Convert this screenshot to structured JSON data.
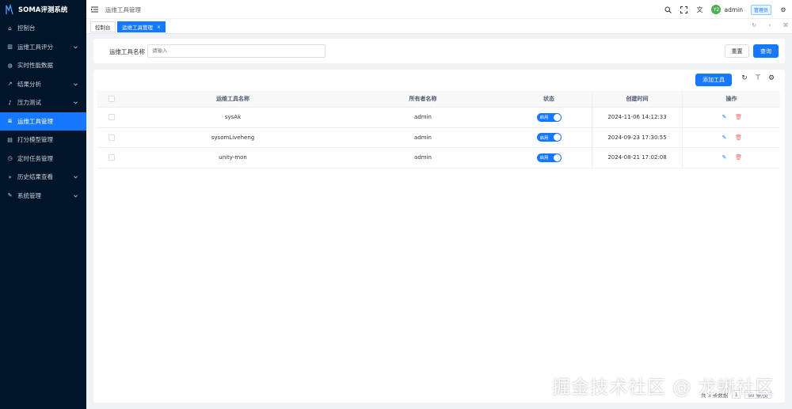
{
  "app": {
    "title": "SOMA评测系统"
  },
  "sidebar": {
    "items": [
      {
        "label": "控制台",
        "icon": "home-icon",
        "has_children": false,
        "active": false
      },
      {
        "label": "运维工具评分",
        "icon": "chart-icon",
        "has_children": true,
        "active": false
      },
      {
        "label": "实时性能数据",
        "icon": "gauge-icon",
        "has_children": false,
        "active": false
      },
      {
        "label": "结果分析",
        "icon": "trend-icon",
        "has_children": true,
        "active": false
      },
      {
        "label": "压力测试",
        "icon": "bell-icon",
        "has_children": true,
        "active": false
      },
      {
        "label": "运维工具管理",
        "icon": "list-icon",
        "has_children": false,
        "active": true
      },
      {
        "label": "打分模型管理",
        "icon": "document-icon",
        "has_children": false,
        "active": false
      },
      {
        "label": "定时任务管理",
        "icon": "clock-icon",
        "has_children": false,
        "active": false
      },
      {
        "label": "历史结果查看",
        "icon": "history-icon",
        "has_children": true,
        "active": false
      },
      {
        "label": "系统管理",
        "icon": "wrench-icon",
        "has_children": true,
        "active": false
      }
    ]
  },
  "header": {
    "breadcrumb": "运维工具管理",
    "username": "admin",
    "avatar_text": "Y2",
    "role": "管理员"
  },
  "tabs": [
    {
      "label": "控制台",
      "active": false
    },
    {
      "label": "运维工具管理",
      "active": true,
      "close": "×"
    }
  ],
  "search": {
    "label": "运维工具名称",
    "placeholder": "请输入",
    "reset_label": "重置",
    "query_label": "查询"
  },
  "toolbar": {
    "add_label": "添加工具"
  },
  "table": {
    "columns": [
      "运维工具名称",
      "所有者名称",
      "状态",
      "创建时间",
      "操作"
    ],
    "rows": [
      {
        "name": "sysAk",
        "owner": "admin",
        "status": "启用",
        "created": "2024-11-06 14:12:33"
      },
      {
        "name": "sysomLiveheng",
        "owner": "admin",
        "status": "启用",
        "created": "2024-09-23 17:30:55"
      },
      {
        "name": "unity-mon",
        "owner": "admin",
        "status": "启用",
        "created": "2024-08-21 17:02:08"
      }
    ]
  },
  "pagination": {
    "total_text": "共 3 条数据",
    "page": "1",
    "page_size": "50 条/页"
  },
  "watermark": "掘金技术社区 @ 龙蜥社区",
  "colors": {
    "primary": "#1677ff",
    "sidebar_bg": "#001529",
    "danger": "#f56c6c"
  }
}
